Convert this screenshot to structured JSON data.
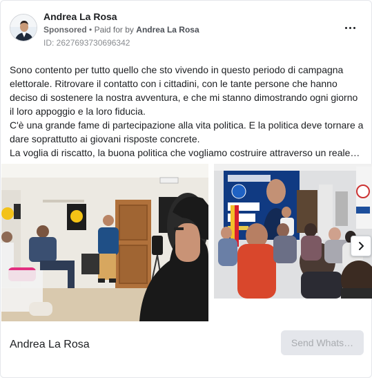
{
  "ad": {
    "advertiser_name": "Andrea La Rosa",
    "sponsored_label": "Sponsored",
    "separator": "•",
    "paid_for_prefix": "Paid for by",
    "payer_name": "Andrea La Rosa",
    "library_id": "ID: 2627693730696342",
    "body_lines": [
      "Sono contento per tutto quello che sto vivendo in questo periodo di campagna elettorale. Ritrovare il contatto con i cittadini, con le tante persone che hanno deciso di sostenere la nostra avventura, e che mi stanno dimostrando ogni giorno il loro appoggio e la loro fiducia.",
      "C'è una grande fame di partecipazione alla vita politica. E la politica deve tornare a dare soprattutto ai giovani risposte concrete.",
      "La voglia di riscatto, la buona politica che vogliamo costruire attraverso un reale…"
    ]
  },
  "carousel": {
    "next_icon": "chevron-right-icon"
  },
  "footer": {
    "page_name": "Andrea La Rosa",
    "cta_label": "Send Whats…"
  },
  "colors": {
    "text_primary": "#1c1e21",
    "text_secondary": "#65676b",
    "cta_background": "#e4e6eb",
    "cta_text": "#a8abaf",
    "card_border": "#e4e6eb"
  }
}
